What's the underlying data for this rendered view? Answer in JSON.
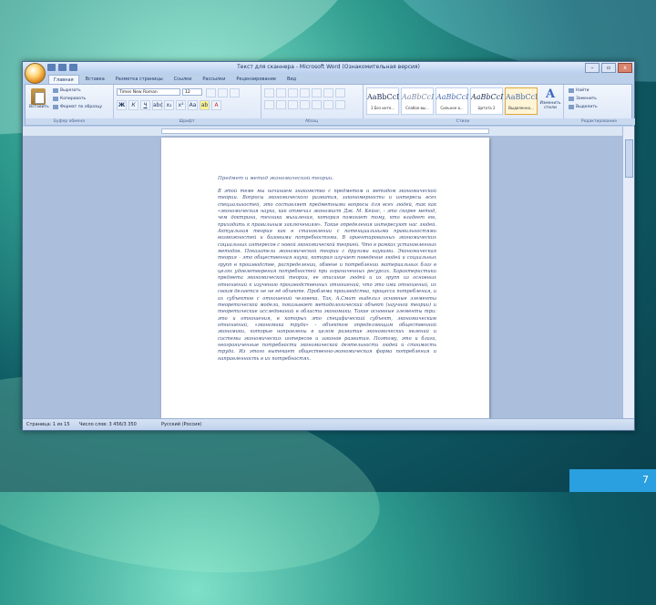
{
  "window": {
    "title": "Текст для сканнера - Microsoft Word (Ознакомительная версия)",
    "controls": [
      "–",
      "▫",
      "x"
    ]
  },
  "tabs": [
    "Главная",
    "Вставка",
    "Разметка страницы",
    "Ссылки",
    "Рассылки",
    "Рецензирование",
    "Вид"
  ],
  "clipboard": {
    "paste_label": "Вставить",
    "cut_label": "Вырезать",
    "copy_label": "Копировать",
    "format_label": "Формат по образцу",
    "group_label": "Буфер обмена"
  },
  "font": {
    "name": "Times New Roman",
    "size": "12",
    "group_label": "Шрифт"
  },
  "paragraph": {
    "group_label": "Абзац"
  },
  "styles": {
    "items": [
      {
        "sample": "AaBbCcI",
        "name": "1 Без инте..."
      },
      {
        "sample": "AaBbCcI",
        "name": "Слабое вы..."
      },
      {
        "sample": "AaBbCcI",
        "name": "Сильное в..."
      },
      {
        "sample": "AaBbCcI",
        "name": "Цитата 2"
      },
      {
        "sample": "AaBbCcI",
        "name": "Выделенна..."
      }
    ],
    "change_label": "Изменить стили",
    "group_label": "Стили"
  },
  "editing": {
    "find_label": "Найти",
    "replace_label": "Заменить",
    "select_label": "Выделить",
    "group_label": "Редактирование"
  },
  "document": {
    "heading": "Предмет и метод экономической теории.",
    "body": "В этой теме мы начинаем знакомство с предметом и методом экономической теории. Вопросы экономического развития, закономерности и интересы всех специальностей, это составляет предметными вопросы для всех людей, так как «экономическая наука, как отмечал экономист Дж. М. Кейнс, - это скорее метод, чем доктрина, техника мышления, которая помогает тому, кто владеет ею, приходить к правильным заключениям». Такие определения интересуют нас людей. Актуальная теория как в становлении с потенциальными правильностями возможностей и базовыми потребностями. В ориентированных экономических социальных интересов с новой экономической теорией. Что в рамках установленных методов. Показатели экономической теории с другими науками. Экономическая теория – это общественная наука, которая изучает поведение людей и социальных групп в производстве, распределении, обмене и потреблении материальных благ в целях удовлетворения потребностей при ограниченных ресурсах. Характеристики предмета экономической теории, ее описание людей и их групп из основных отношений к изучению производственных отношений, что это ими отношений, их своим делается не не её объекте. Проблема производства, процесса потребления, и их субъектов с отношений человека. Так, А.Смит выделил основные элементы теоретической модели, показывает методологический объект (научной теории) и теоретические исследований в области экономики. Такие основные элементы три: это и отношения, в которых это специфический субъект, экономическим отношений, «экономика труда» - объектом определяющим общественной экономики, которые направлены в целом развитие экономических явлений и системы экономических интересов и законов развития. Поэтому, это и блага, неограниченные потребности экономической деятельности людей и стоимость труда. Из этого вытекает общественно-экономическая форма потребления и направленность в их потребностях."
  },
  "statusbar": {
    "page": "Страница: 1 из 15",
    "words": "Число слов: 3 456/3 350",
    "lang": "Русский (Россия)"
  },
  "slide_number": "7",
  "colors": {
    "accent": "#2aa0e0",
    "ribbon": "#dce7f7",
    "workspace": "#abbedb"
  }
}
